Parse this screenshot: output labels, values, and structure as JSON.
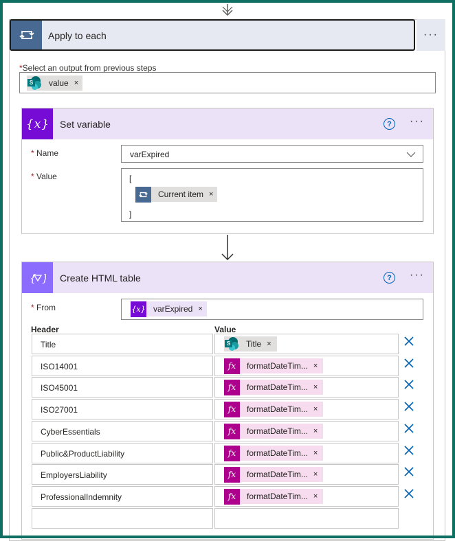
{
  "apply_to_each": {
    "title": "Apply to each",
    "more": "···",
    "select_label": "Select an output from previous steps",
    "required_mark": "*",
    "output_token": "value",
    "remove": "×"
  },
  "set_variable": {
    "title": "Set variable",
    "help": "?",
    "more": "···",
    "name_label": "Name",
    "name_value": "varExpired",
    "value_label": "Value",
    "open_bracket": "[",
    "close_bracket": "]",
    "value_token": "Current item",
    "remove": "×"
  },
  "html_table": {
    "title": "Create HTML table",
    "help": "?",
    "more": "···",
    "from_label": "From",
    "from_token": "varExpired",
    "remove": "×",
    "header_col": "Header",
    "value_col": "Value",
    "rows": [
      {
        "header": "Title",
        "value": "Title",
        "kind": "sharepoint"
      },
      {
        "header": "ISO14001",
        "value": "formatDateTim...",
        "kind": "expression"
      },
      {
        "header": "ISO45001",
        "value": "formatDateTim...",
        "kind": "expression"
      },
      {
        "header": "ISO27001",
        "value": "formatDateTim...",
        "kind": "expression"
      },
      {
        "header": "CyberEssentials",
        "value": "formatDateTim...",
        "kind": "expression"
      },
      {
        "header": "Public&ProductLiability",
        "value": "formatDateTim...",
        "kind": "expression"
      },
      {
        "header": "EmployersLiability",
        "value": "formatDateTim...",
        "kind": "expression"
      },
      {
        "header": "ProfessionalIndemnity",
        "value": "formatDateTim...",
        "kind": "expression"
      }
    ],
    "fx_label": "fx",
    "var_icon_label": "{x}"
  },
  "colors": {
    "frame": "#0f6f63",
    "loop_icon": "#486991",
    "variable_icon": "#770bd6",
    "table_icon": "#8c6cff",
    "expression_icon": "#ad008c",
    "link_blue": "#0063b1"
  }
}
